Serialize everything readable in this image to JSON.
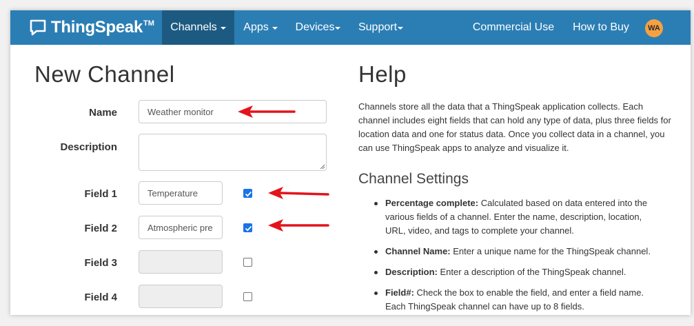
{
  "brand": {
    "name": "ThingSpeak",
    "tm": "TM"
  },
  "nav": {
    "items": [
      {
        "label": "Channels",
        "active": true,
        "caret": true
      },
      {
        "label": "Apps",
        "active": false,
        "caret": true
      },
      {
        "label": "Devices",
        "active": false,
        "caret": true
      },
      {
        "label": "Support",
        "active": false,
        "caret": true
      }
    ],
    "right": [
      {
        "label": "Commercial Use"
      },
      {
        "label": "How to Buy"
      }
    ],
    "avatar": "WA"
  },
  "form": {
    "title": "New Channel",
    "name": {
      "label": "Name",
      "value": "Weather monitor"
    },
    "description": {
      "label": "Description",
      "value": ""
    },
    "fields": [
      {
        "label": "Field 1",
        "value": "Temperature",
        "checked": true
      },
      {
        "label": "Field 2",
        "value": "Atmospheric pre",
        "checked": true
      },
      {
        "label": "Field 3",
        "value": "",
        "checked": false
      },
      {
        "label": "Field 4",
        "value": "",
        "checked": false
      }
    ]
  },
  "help": {
    "title": "Help",
    "intro": "Channels store all the data that a ThingSpeak application collects. Each channel includes eight fields that can hold any type of data, plus three fields for location data and one for status data. Once you collect data in a channel, you can use ThingSpeak apps to analyze and visualize it.",
    "settings_title": "Channel Settings",
    "items": [
      {
        "term": "Percentage complete:",
        "text": " Calculated based on data entered into the various fields of a channel. Enter the name, description, location, URL, video, and tags to complete your channel."
      },
      {
        "term": "Channel Name:",
        "text": " Enter a unique name for the ThingSpeak channel."
      },
      {
        "term": "Description:",
        "text": " Enter a description of the ThingSpeak channel."
      },
      {
        "term": "Field#:",
        "text": " Check the box to enable the field, and enter a field name. Each ThingSpeak channel can have up to 8 fields."
      }
    ]
  },
  "colors": {
    "navbar": "#2b7eb4",
    "navbar_active": "#1d5a82",
    "avatar": "#f5a142",
    "annotation_arrow": "#e3141b",
    "checkbox": "#1a73e8"
  }
}
